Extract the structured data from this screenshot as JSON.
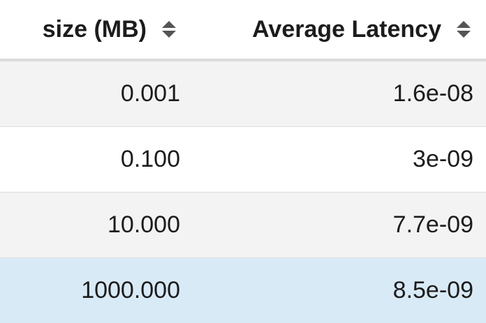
{
  "table": {
    "columns": [
      {
        "label": "size (MB)",
        "sort_icon": "sort-both-icon"
      },
      {
        "label": "Average Latency",
        "sort_icon": "sort-both-icon"
      }
    ],
    "rows": [
      {
        "size": "0.001",
        "latency": "1.6e-08"
      },
      {
        "size": "0.100",
        "latency": "3e-09"
      },
      {
        "size": "10.000",
        "latency": "7.7e-09"
      },
      {
        "size": "1000.000",
        "latency": "8.5e-09"
      }
    ],
    "selected_row_index": 3
  },
  "colors": {
    "header_border": "#dcdcdc",
    "row_odd": "#f3f3f3",
    "row_even": "#ffffff",
    "row_selected": "#d9eaf7",
    "sort_icon": "#555555"
  }
}
